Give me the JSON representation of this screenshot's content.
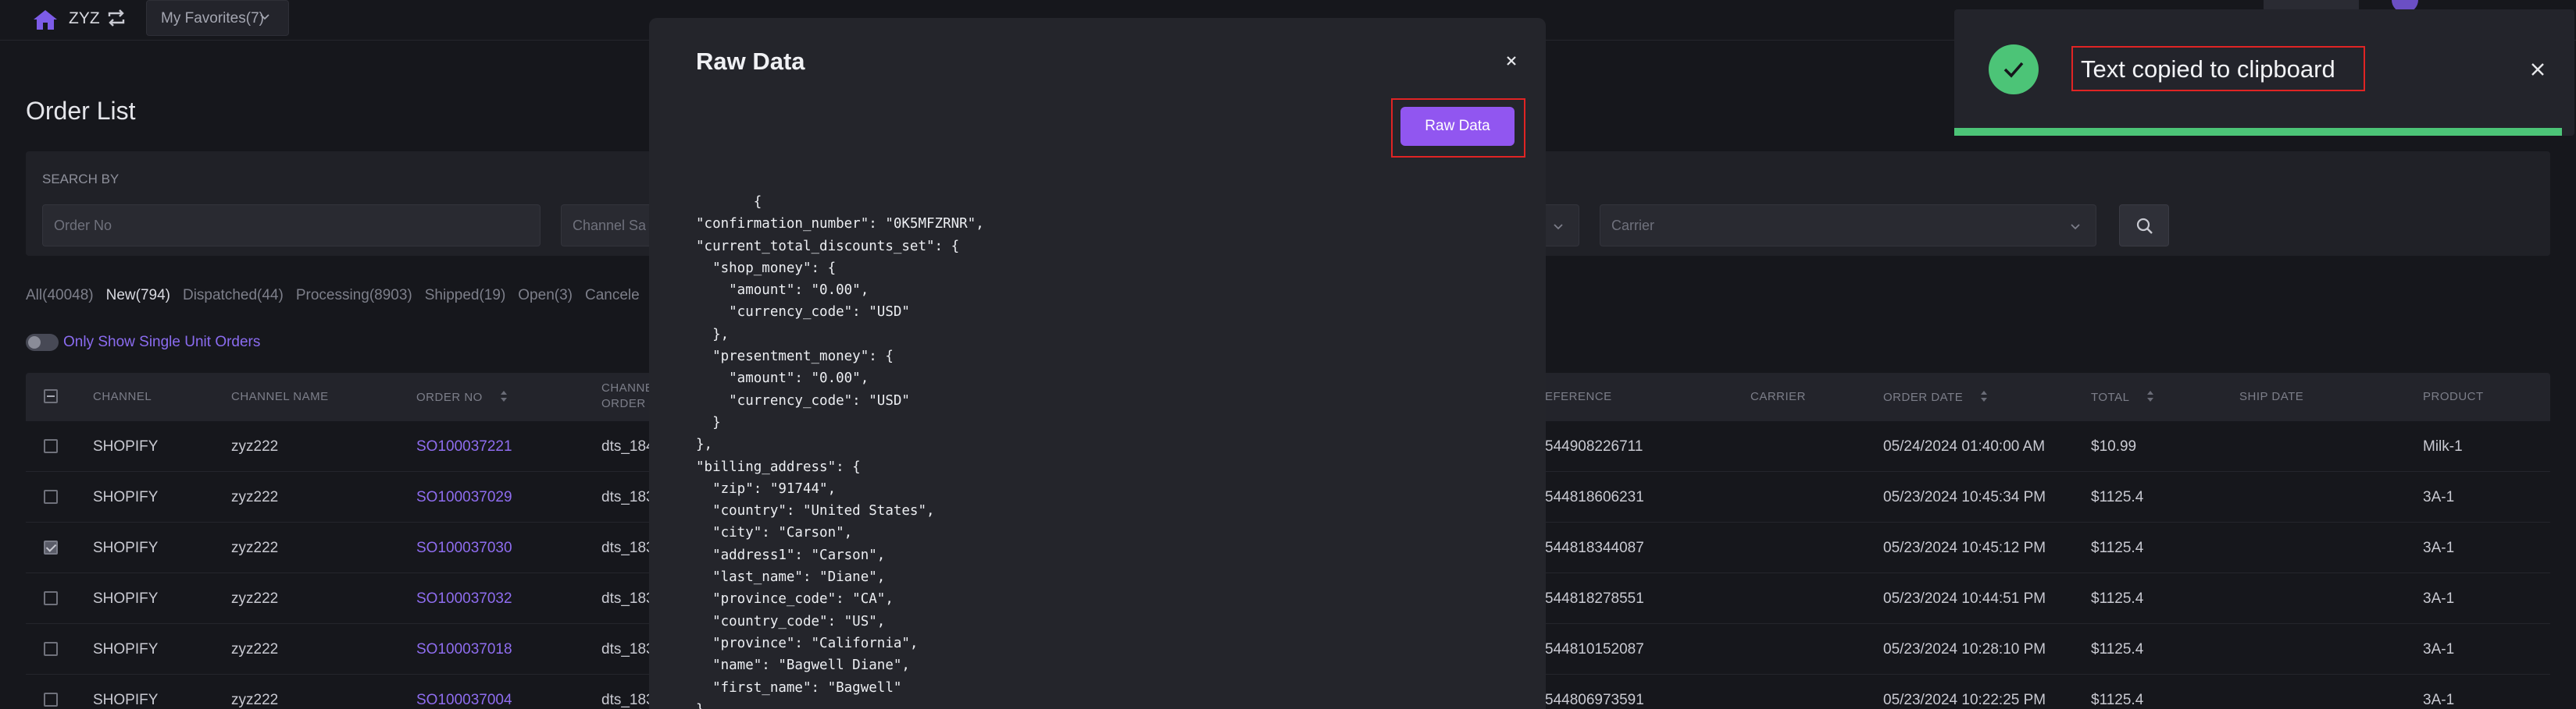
{
  "topbar": {
    "brand": "ZYZ",
    "favorites_label": "My Favorites(7)"
  },
  "page": {
    "title": "Order List",
    "search_by_label": "SEARCH BY"
  },
  "search": {
    "order_no_placeholder": "Order No",
    "channel_placeholder": "Channel Sa",
    "carrier_placeholder": "Carrier"
  },
  "tabs": [
    {
      "label": "All(40048)"
    },
    {
      "label": "New(794)"
    },
    {
      "label": "Dispatched(44)"
    },
    {
      "label": "Processing(8903)"
    },
    {
      "label": "Shipped(19)"
    },
    {
      "label": "Open(3)"
    },
    {
      "label": "Cancele"
    }
  ],
  "toggle_label": "Only Show Single Unit Orders",
  "table": {
    "headers": {
      "channel": "CHANNEL",
      "channel_name": "CHANNEL NAME",
      "order_no": "ORDER NO",
      "channel_order_line1": "CHANNE",
      "channel_order_line2": "ORDER",
      "reference": "EFERENCE",
      "carrier": "CARRIER",
      "order_date": "ORDER DATE",
      "total": "TOTAL",
      "ship_date": "SHIP DATE",
      "product": "PRODUCT"
    },
    "rows": [
      {
        "channel": "SHOPIFY",
        "channel_name": "zyz222",
        "order_no": "SO100037221",
        "channel_order": "dts_184",
        "reference": "544908226711",
        "order_date": "05/24/2024 01:40:00 AM",
        "total": "$10.99",
        "product": "Milk-1",
        "checked": false
      },
      {
        "channel": "SHOPIFY",
        "channel_name": "zyz222",
        "order_no": "SO100037029",
        "channel_order": "dts_183",
        "reference": "544818606231",
        "order_date": "05/23/2024 10:45:34 PM",
        "total": "$1125.4",
        "product": "3A-1",
        "checked": false
      },
      {
        "channel": "SHOPIFY",
        "channel_name": "zyz222",
        "order_no": "SO100037030",
        "channel_order": "dts_183",
        "reference": "544818344087",
        "order_date": "05/23/2024 10:45:12 PM",
        "total": "$1125.4",
        "product": "3A-1",
        "checked": true
      },
      {
        "channel": "SHOPIFY",
        "channel_name": "zyz222",
        "order_no": "SO100037032",
        "channel_order": "dts_183",
        "reference": "544818278551",
        "order_date": "05/23/2024 10:44:51 PM",
        "total": "$1125.4",
        "product": "3A-1",
        "checked": false
      },
      {
        "channel": "SHOPIFY",
        "channel_name": "zyz222",
        "order_no": "SO100037018",
        "channel_order": "dts_183",
        "reference": "544810152087",
        "order_date": "05/23/2024 10:28:10 PM",
        "total": "$1125.4",
        "product": "3A-1",
        "checked": false
      },
      {
        "channel": "SHOPIFY",
        "channel_name": "zyz222",
        "order_no": "SO100037004",
        "channel_order": "dts_183",
        "reference": "544806973591",
        "order_date": "05/23/2024 10:22:25 PM",
        "total": "$1125.4",
        "product": "3A-1",
        "checked": false
      }
    ]
  },
  "modal": {
    "title": "Raw Data",
    "button_label": "Raw Data",
    "json_text": "       {\n\"confirmation_number\": \"0K5MFZRNR\",\n\"current_total_discounts_set\": {\n  \"shop_money\": {\n    \"amount\": \"0.00\",\n    \"currency_code\": \"USD\"\n  },\n  \"presentment_money\": {\n    \"amount\": \"0.00\",\n    \"currency_code\": \"USD\"\n  }\n},\n\"billing_address\": {\n  \"zip\": \"91744\",\n  \"country\": \"United States\",\n  \"city\": \"Carson\",\n  \"address1\": \"Carson\",\n  \"last_name\": \"Diane\",\n  \"province_code\": \"CA\",\n  \"country_code\": \"US\",\n  \"province\": \"California\",\n  \"name\": \"Bagwell Diane\",\n  \"first_name\": \"Bagwell\"\n},"
  },
  "toast": {
    "message": "Text copied to clipboard",
    "progress": 0.98
  },
  "colors": {
    "accent": "#9156f0",
    "success": "#4cc477",
    "highlight_frame": "#e02424",
    "background": "#16171c"
  }
}
